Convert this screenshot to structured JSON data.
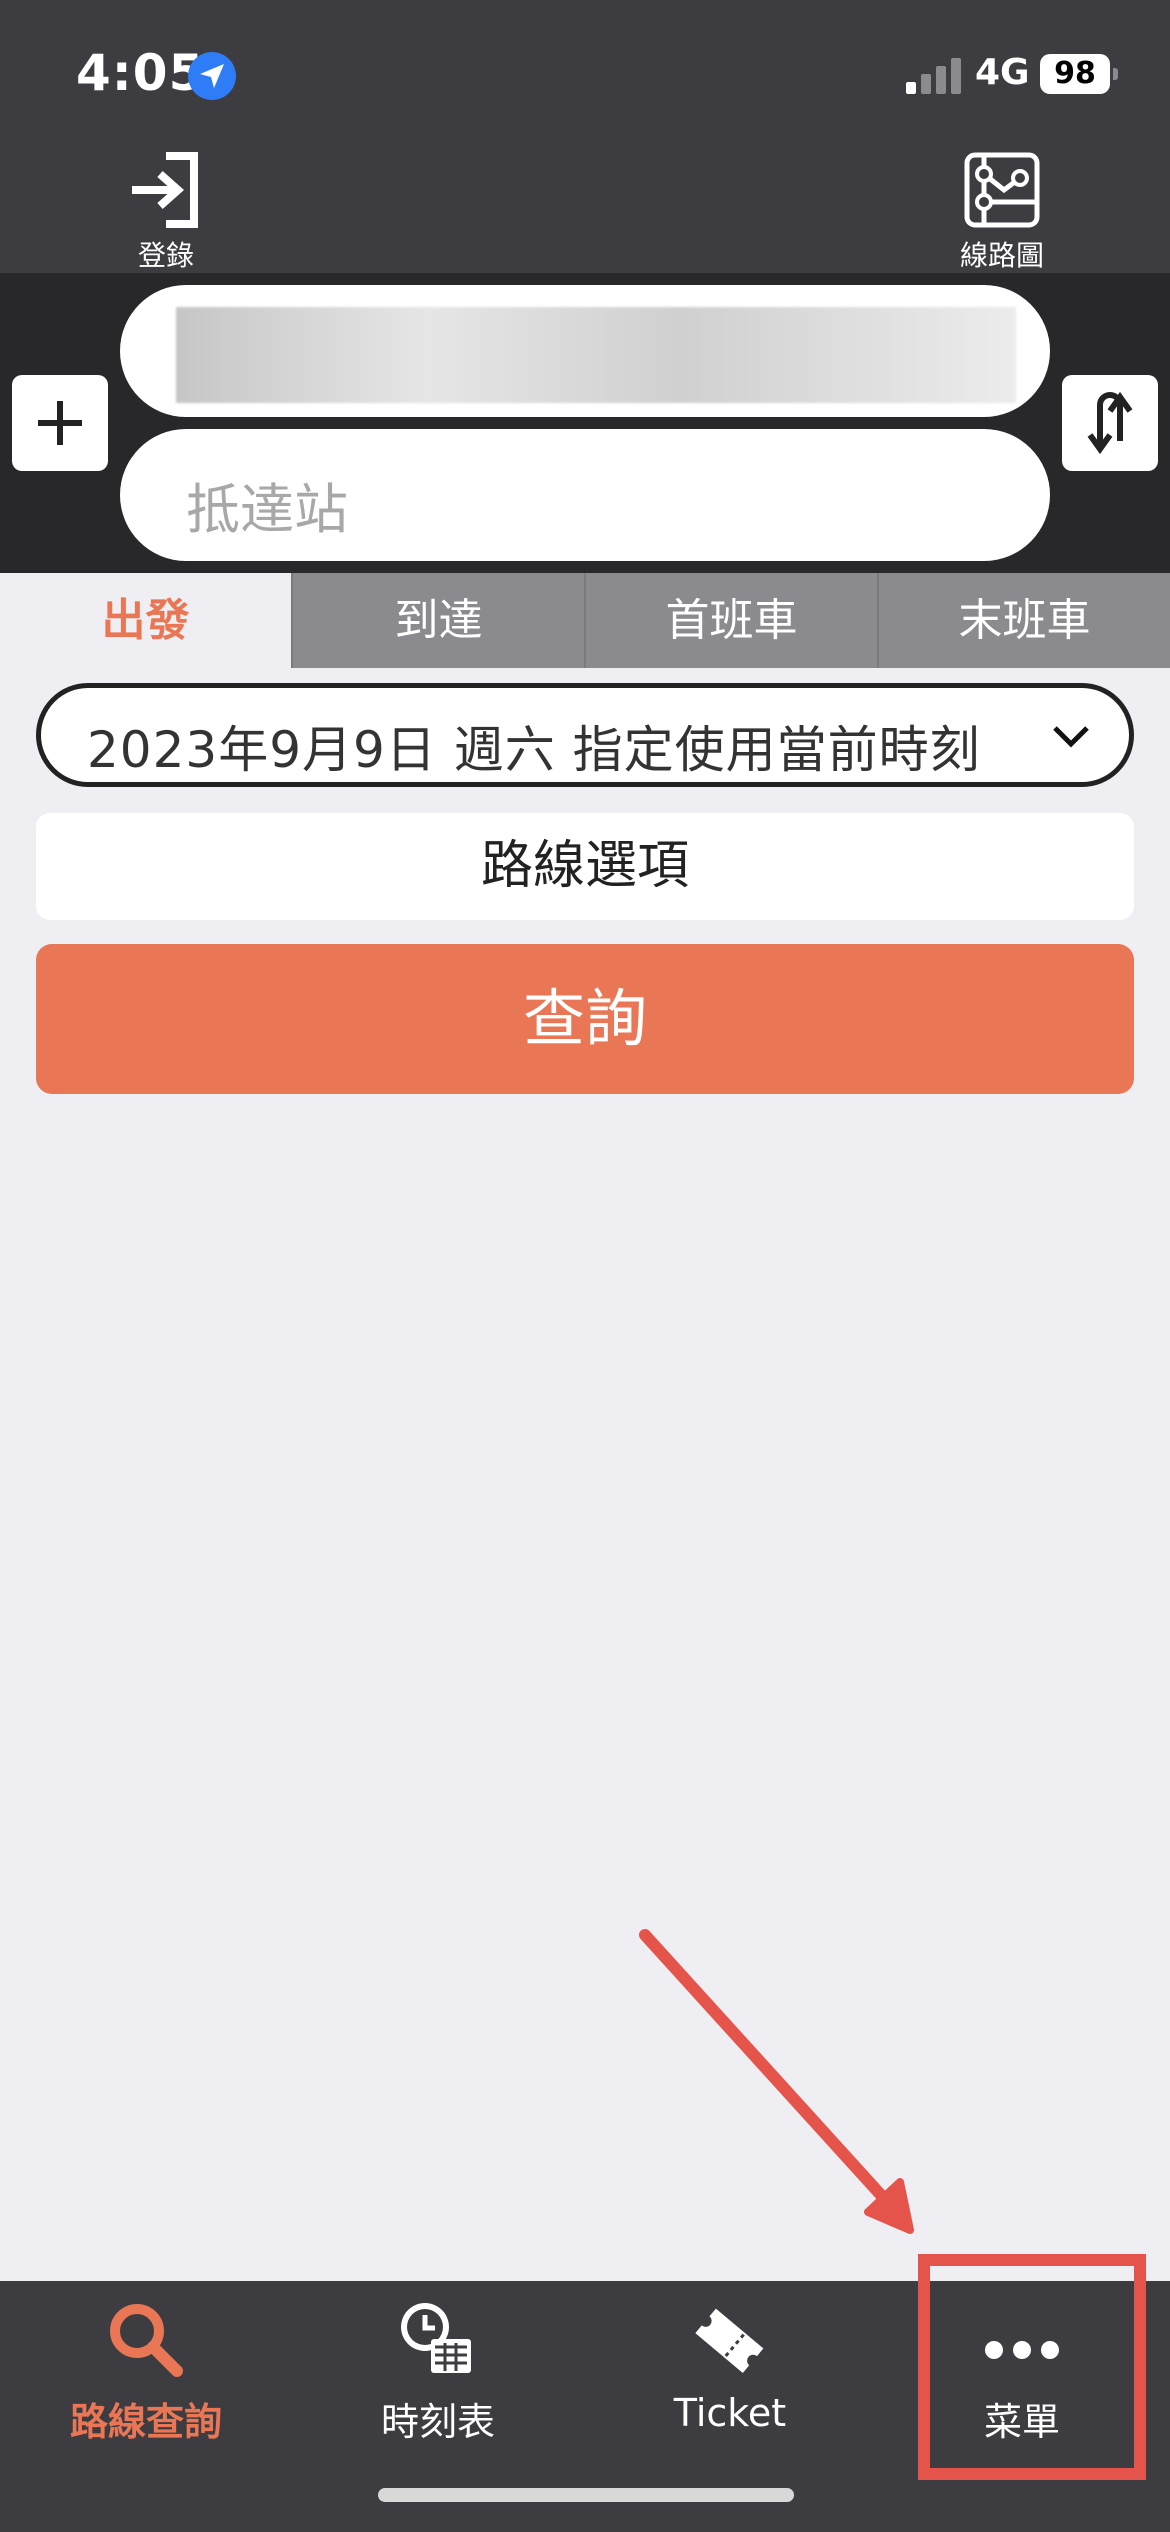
{
  "status_bar": {
    "time": "4:05",
    "network": "4G",
    "battery": "98"
  },
  "header": {
    "login_label": "登錄",
    "route_map_label": "線路圖"
  },
  "search": {
    "arrival_placeholder": "抵達站"
  },
  "tabs": [
    {
      "label": "出發",
      "active": true
    },
    {
      "label": "到達",
      "active": false
    },
    {
      "label": "首班車",
      "active": false
    },
    {
      "label": "末班車",
      "active": false
    }
  ],
  "date_select": {
    "value": "2023年9月9日 週六 指定使用當前時刻"
  },
  "route_options_label": "路線選項",
  "query_label": "查詢",
  "tab_bar": [
    {
      "label": "路線查詢",
      "icon": "search-icon",
      "active": true
    },
    {
      "label": "時刻表",
      "icon": "timetable-icon",
      "active": false
    },
    {
      "label": "Ticket",
      "icon": "ticket-icon",
      "active": false
    },
    {
      "label": "菜單",
      "icon": "more-icon",
      "active": false
    }
  ],
  "colors": {
    "accent": "#e97655",
    "header_bg": "#3c3c41",
    "annotation": "#e5544a"
  }
}
